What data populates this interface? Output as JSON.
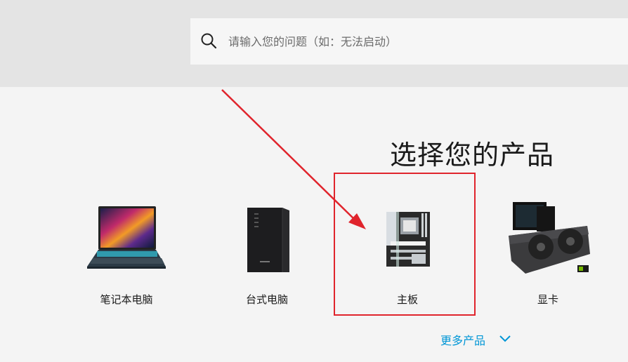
{
  "search": {
    "placeholder": "请输入您的问题（如：无法启动）",
    "icon": "search-icon"
  },
  "section_title": "选择您的产品",
  "products": [
    {
      "label": "笔记本电脑",
      "icon": "laptop-icon"
    },
    {
      "label": "台式电脑",
      "icon": "desktop-tower-icon"
    },
    {
      "label": "主板",
      "icon": "motherboard-icon"
    },
    {
      "label": "显卡",
      "icon": "graphics-card-icon"
    }
  ],
  "more_products": {
    "label": "更多产品",
    "icon": "chevron-down-icon"
  },
  "annotation": {
    "color": "#e0242c"
  },
  "colors": {
    "link": "#0096d6",
    "top_band": "#e4e4e4",
    "page_bg": "#f4f4f4"
  }
}
